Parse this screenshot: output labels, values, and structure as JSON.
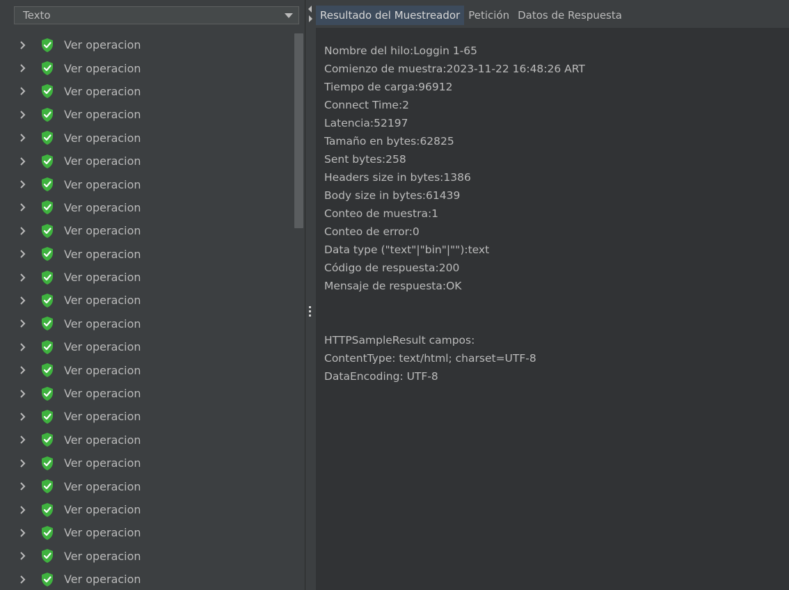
{
  "left_panel": {
    "renderer_combo": {
      "value": "Texto"
    },
    "tree_items": [
      {
        "label": "Ver operacion"
      },
      {
        "label": "Ver operacion"
      },
      {
        "label": "Ver operacion"
      },
      {
        "label": "Ver operacion"
      },
      {
        "label": "Ver operacion"
      },
      {
        "label": "Ver operacion"
      },
      {
        "label": "Ver operacion"
      },
      {
        "label": "Ver operacion"
      },
      {
        "label": "Ver operacion"
      },
      {
        "label": "Ver operacion"
      },
      {
        "label": "Ver operacion"
      },
      {
        "label": "Ver operacion"
      },
      {
        "label": "Ver operacion"
      },
      {
        "label": "Ver operacion"
      },
      {
        "label": "Ver operacion"
      },
      {
        "label": "Ver operacion"
      },
      {
        "label": "Ver operacion"
      },
      {
        "label": "Ver operacion"
      },
      {
        "label": "Ver operacion"
      },
      {
        "label": "Ver operacion"
      },
      {
        "label": "Ver operacion"
      },
      {
        "label": "Ver operacion"
      },
      {
        "label": "Ver operacion"
      },
      {
        "label": "Ver operacion"
      }
    ],
    "item_icon": "green-shield-check-icon",
    "expand_icon": "chevron-right-icon"
  },
  "right_panel": {
    "tabs": [
      {
        "label": "Resultado del Muestreador",
        "active": true
      },
      {
        "label": "Petición",
        "active": false
      },
      {
        "label": "Datos de Respuesta",
        "active": false
      }
    ],
    "result_lines": [
      "Nombre del hilo:Loggin 1-65",
      "Comienzo de muestra:2023-11-22 16:48:26 ART",
      "Tiempo de carga:96912",
      "Connect Time:2",
      "Latencia:52197",
      "Tamaño en bytes:62825",
      "Sent bytes:258",
      "Headers size in bytes:1386",
      "Body size in bytes:61439",
      "Conteo de muestra:1",
      "Conteo de error:0",
      "Data type (\"text\"|\"bin\"|\"\"):text",
      "Código de respuesta:200",
      "Mensaje de respuesta:OK",
      "",
      "",
      "HTTPSampleResult campos:",
      "ContentType: text/html; charset=UTF-8",
      "DataEncoding: UTF-8"
    ]
  },
  "colors": {
    "background": "#3c3f41",
    "content_bg": "#313335",
    "text": "#bbbbbb",
    "shield_green": "#3fb23f",
    "tab_active": "#3d4b5c",
    "tab_underline": "#4a88c7"
  }
}
